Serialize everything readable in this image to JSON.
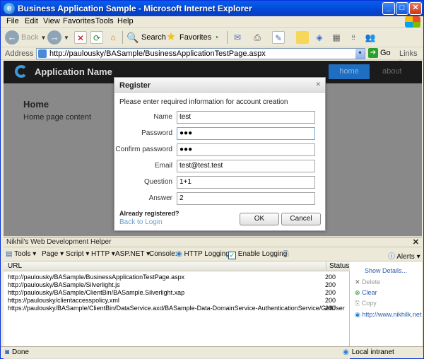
{
  "window": {
    "title": "Business Application Sample - Microsoft Internet Explorer"
  },
  "menu": [
    "File",
    "Edit",
    "View",
    "Favorites",
    "Tools",
    "Help"
  ],
  "toolbar": {
    "back": "Back",
    "search": "Search",
    "favorites": "Favorites"
  },
  "address": {
    "label": "Address",
    "url": "http://paulousky/BASample/BusinessApplicationTestPage.aspx",
    "go": "Go",
    "links": "Links"
  },
  "app": {
    "name": "Application Name",
    "nav": [
      "home",
      "about"
    ],
    "heading": "Home",
    "content": "Home page content"
  },
  "dialog": {
    "title": "Register",
    "message": "Please enter required information for account creation",
    "fields": [
      {
        "label": "Name",
        "value": "test"
      },
      {
        "label": "Password",
        "value": "●●●"
      },
      {
        "label": "Confirm password",
        "value": "●●●"
      },
      {
        "label": "Email",
        "value": "test@test.test"
      },
      {
        "label": "Question",
        "value": "1+1"
      },
      {
        "label": "Answer",
        "value": "2"
      }
    ],
    "already": "Already registered?",
    "back_to_login": "Back to Login",
    "ok": "OK",
    "cancel": "Cancel"
  },
  "devhelper": {
    "title": "Nikhil's Web Development Helper",
    "toolbar": [
      "Tools",
      "Page",
      "Script",
      "HTTP",
      "ASP.NET",
      "Console:",
      "HTTP Logging",
      "Enable Logging",
      "Alerts"
    ],
    "columns": [
      "URL",
      "Status"
    ],
    "rows": [
      {
        "url": "http://paulousky/BASample/BusinessApplicationTestPage.aspx",
        "status": "200"
      },
      {
        "url": "http://paulousky/BASample/Silverlight.js",
        "status": "200"
      },
      {
        "url": "http://paulousky/BASample/ClientBin/BASample.Silverlight.xap",
        "status": "200"
      },
      {
        "url": "https://paulousky/clientaccesspolicy.xml",
        "status": "200"
      },
      {
        "url": "https://paulousky/BASample/ClientBin/DataService.axd/BASample-Data-DomainService-AuthenticationService/GetUser",
        "status": "200"
      }
    ],
    "side": [
      "Show Details...",
      "Delete",
      "Clear",
      "Copy",
      "http://www.nikhilk.net"
    ]
  },
  "status": {
    "left": "Done",
    "zone": "Local intranet"
  }
}
